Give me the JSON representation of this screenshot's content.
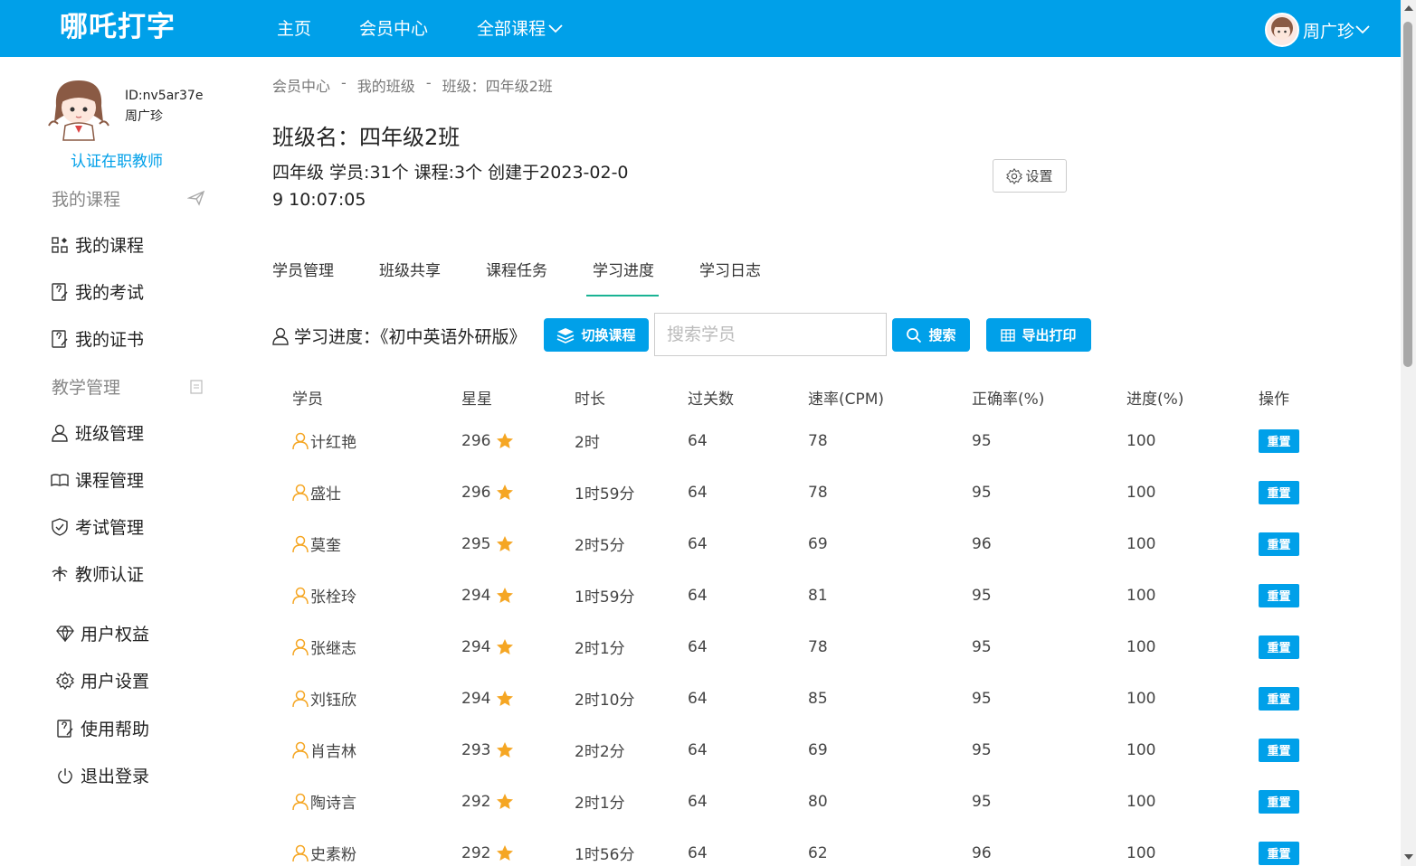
{
  "header": {
    "logo": "哪吒打字",
    "nav": [
      "主页",
      "会员中心",
      "全部课程"
    ],
    "user_name": "周广珍"
  },
  "sidebar": {
    "id_text": "ID:nv5ar37e",
    "name": "周广珍",
    "certify": "认证在职教师",
    "section_courses": "我的课程",
    "items1": [
      "我的课程",
      "我的考试",
      "我的证书"
    ],
    "section_teaching": "教学管理",
    "items2": [
      "班级管理",
      "课程管理",
      "考试管理",
      "教师认证"
    ],
    "items3": [
      "用户权益",
      "用户设置",
      "使用帮助",
      "退出登录"
    ]
  },
  "breadcrumb": [
    "会员中心",
    "-",
    "我的班级",
    "-",
    "班级：四年级2班"
  ],
  "class": {
    "title": "班级名：四年级2班",
    "info": "四年级 学员:31个 课程:3个 创建于2023-02-09 10:07:05",
    "settings_label": "设置"
  },
  "tabs": [
    "学员管理",
    "班级共享",
    "课程任务",
    "学习进度",
    "学习日志"
  ],
  "active_tab": "学习进度",
  "toolbar": {
    "progress_label": "学习进度：《初中英语外研版》",
    "switch_label": "切换课程",
    "search_placeholder": "搜索学员",
    "search_label": "搜索",
    "export_label": "导出打印"
  },
  "table": {
    "headers": [
      "学员",
      "星星",
      "时长",
      "过关数",
      "速率(CPM)",
      "正确率(%)",
      "进度(%)",
      "操作"
    ],
    "reset_label": "重置",
    "rows": [
      {
        "name": "计红艳",
        "stars": "296",
        "duration": "2时",
        "passed": "64",
        "cpm": "78",
        "accuracy": "95",
        "progress": "100"
      },
      {
        "name": "盛壮",
        "stars": "296",
        "duration": "1时59分",
        "passed": "64",
        "cpm": "78",
        "accuracy": "95",
        "progress": "100"
      },
      {
        "name": "莫奎",
        "stars": "295",
        "duration": "2时5分",
        "passed": "64",
        "cpm": "69",
        "accuracy": "96",
        "progress": "100"
      },
      {
        "name": "张栓玲",
        "stars": "294",
        "duration": "1时59分",
        "passed": "64",
        "cpm": "81",
        "accuracy": "95",
        "progress": "100"
      },
      {
        "name": "张继志",
        "stars": "294",
        "duration": "2时1分",
        "passed": "64",
        "cpm": "78",
        "accuracy": "95",
        "progress": "100"
      },
      {
        "name": "刘钰欣",
        "stars": "294",
        "duration": "2时10分",
        "passed": "64",
        "cpm": "85",
        "accuracy": "95",
        "progress": "100"
      },
      {
        "name": "肖吉林",
        "stars": "293",
        "duration": "2时2分",
        "passed": "64",
        "cpm": "69",
        "accuracy": "95",
        "progress": "100"
      },
      {
        "name": "陶诗言",
        "stars": "292",
        "duration": "2时1分",
        "passed": "64",
        "cpm": "80",
        "accuracy": "95",
        "progress": "100"
      },
      {
        "name": "史素粉",
        "stars": "292",
        "duration": "1时56分",
        "passed": "64",
        "cpm": "62",
        "accuracy": "96",
        "progress": "100"
      }
    ]
  },
  "colors": {
    "primary": "#00a0e9",
    "tab_underline": "#1ab394",
    "star": "#f5a623",
    "user_icon": "#f5a623"
  }
}
